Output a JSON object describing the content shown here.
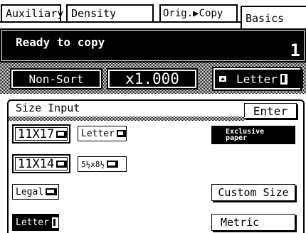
{
  "tabs": [
    {
      "label": "Auxiliary"
    },
    {
      "label": "Density"
    },
    {
      "label": "Orig.▶Copy"
    },
    {
      "label": "Basics",
      "active": true
    }
  ],
  "status": {
    "message": "Ready to copy",
    "copy_count": "1"
  },
  "settings_row": {
    "sort_label": "Non-Sort",
    "zoom_label": "x1.000",
    "paper_label": "Letter"
  },
  "size_input": {
    "title": "Size Input",
    "enter_label": "Enter",
    "sizes": [
      {
        "label": "11X17"
      },
      {
        "label": "Letter"
      },
      {
        "label": "11X14"
      },
      {
        "label": "5½x8½"
      },
      {
        "label": "Legal"
      },
      {
        "label": "Letter",
        "selected": true
      }
    ],
    "exclusive_label": "Exclusive paper",
    "custom_size_label": "Custom Size",
    "metric_label": "Metric"
  },
  "colors": {
    "foreground": "#000000",
    "background": "#ffffff"
  }
}
